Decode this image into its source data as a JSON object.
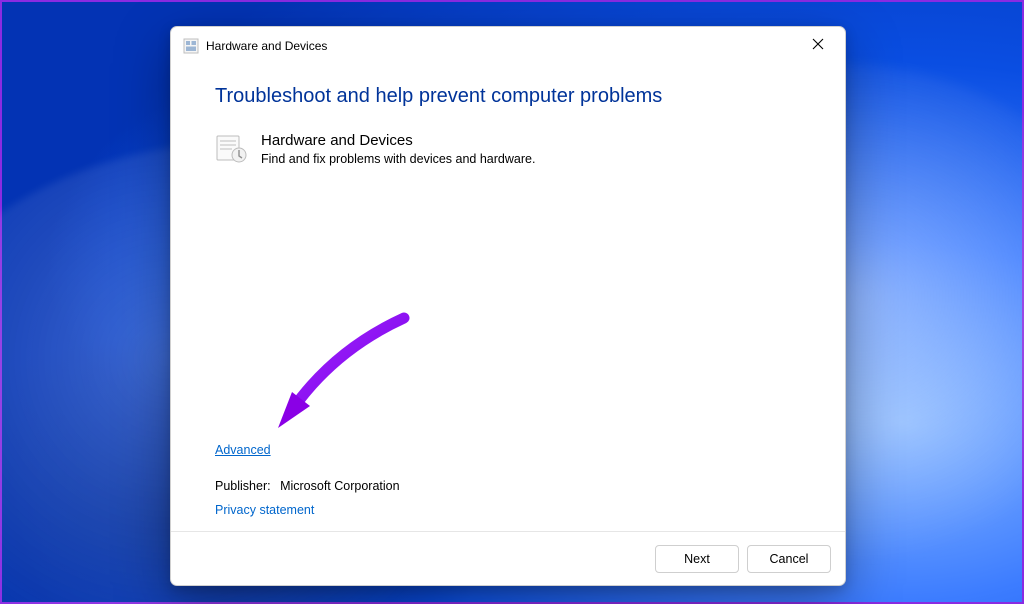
{
  "window": {
    "title": "Hardware and Devices"
  },
  "heading": "Troubleshoot and help prevent computer problems",
  "troubleshooter": {
    "title": "Hardware and Devices",
    "description": "Find and fix problems with devices and hardware."
  },
  "links": {
    "advanced": "Advanced",
    "privacy": "Privacy statement"
  },
  "publisher": {
    "label": "Publisher:",
    "value": "Microsoft Corporation"
  },
  "buttons": {
    "next": "Next",
    "cancel": "Cancel"
  }
}
